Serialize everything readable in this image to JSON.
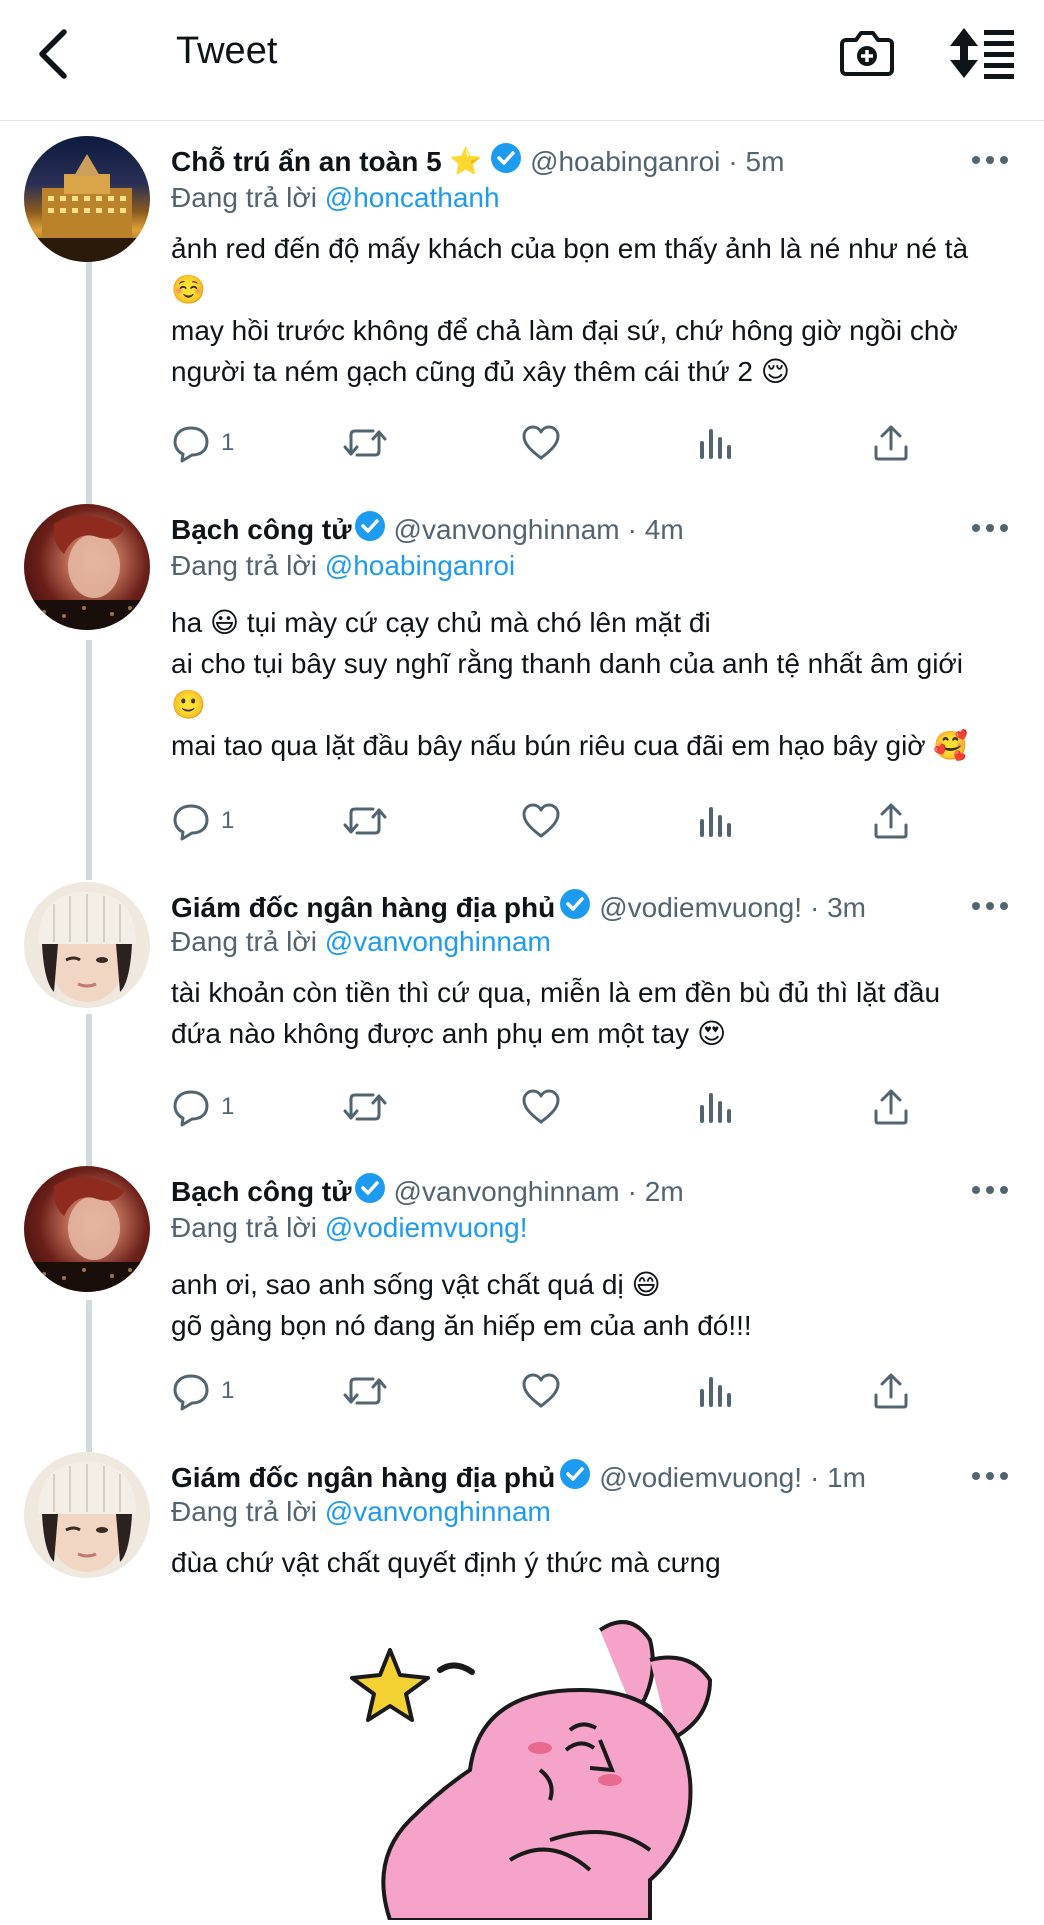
{
  "header": {
    "title": "Tweet",
    "back_icon": "chevron-left-icon",
    "camera_icon": "camera-plus-icon",
    "sort_icon": "sort-arrows-icon"
  },
  "tweets": [
    {
      "name": "Chỗ trú ẩn an toàn 5",
      "name_emoji": "⭐",
      "verified": true,
      "handle": "@hoabinganroi",
      "time": "· 5m",
      "reply_prefix": "Đang trả lời",
      "reply_to": "@honcathanh",
      "lines": [
        "ảnh red đến độ mấy khách của bọn em thấy ảnh là né như né tà",
        "☺️",
        "may hồi trước không để chả làm đại sứ, chứ hông giờ ngồi chờ",
        "người ta ném gạch cũng đủ xây thêm cái thứ 2 😌"
      ],
      "reply_count": "1"
    },
    {
      "name": "Bạch công tử",
      "verified": true,
      "handle": "@vanvonghinnam",
      "time": "· 4m",
      "reply_prefix": "Đang trả lời",
      "reply_to": "@hoabinganroi",
      "lines": [
        "ha 😃 tụi mày cứ cạy chủ mà chó lên mặt đi",
        "ai cho tụi bây suy nghĩ rằng thanh danh của anh tệ nhất âm giới",
        "🙂",
        "mai tao qua lặt đầu bây nấu bún riêu cua đãi em hạo bây giờ 🥰"
      ],
      "reply_count": "1"
    },
    {
      "name": "Giám đốc ngân hàng địa phủ",
      "verified": true,
      "handle": "@vodiemvuong!",
      "time": "· 3m",
      "reply_prefix": "Đang trả lời",
      "reply_to": "@vanvonghinnam",
      "lines": [
        "tài khoản còn tiền thì cứ qua, miễn là em đền bù đủ thì lặt đầu",
        "đứa nào không được anh phụ em một tay 😍"
      ],
      "reply_count": "1"
    },
    {
      "name": "Bạch công tử",
      "verified": true,
      "handle": "@vanvonghinnam",
      "time": "· 2m",
      "reply_prefix": "Đang trả lời",
      "reply_to": "@vodiemvuong!",
      "lines": [
        "anh ơi, sao anh sống vật chất quá dị 😄",
        "gõ gàng bọn nó đang ăn hiếp em của anh đó!!!"
      ],
      "reply_count": "1"
    },
    {
      "name": "Giám đốc ngân hàng địa phủ",
      "verified": true,
      "handle": "@vodiemvuong!",
      "time": "· 1m",
      "reply_prefix": "Đang trả lời",
      "reply_to": "@vanvonghinnam",
      "lines": [
        "đùa chứ vật chất quyết định ý thức mà cưng"
      ]
    }
  ],
  "action_icons": [
    "reply-icon",
    "retweet-icon",
    "like-icon",
    "analytics-icon",
    "share-icon"
  ],
  "colors": {
    "link": "#1d9bf0",
    "verified": "#1d9bf0",
    "secondary_text": "#536471",
    "thread_line": "#cfd9de",
    "sticker_pink": "#f5a3c8"
  }
}
